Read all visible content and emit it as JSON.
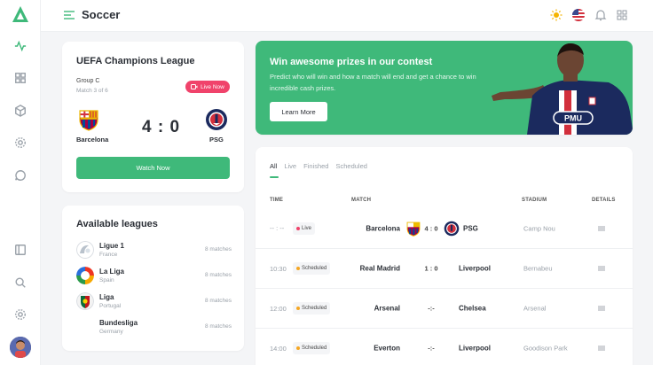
{
  "header": {
    "title": "Soccer"
  },
  "match_card": {
    "title": "UEFA Champions League",
    "group": "Group C",
    "subtitle": "Match 3 of 6",
    "live_label": "Live Now",
    "home_team": "Barcelona",
    "away_team": "PSG",
    "score": "4 : 0",
    "watch_label": "Watch Now"
  },
  "promo": {
    "title": "Win awesome prizes in our contest",
    "text": "Predict who will win and how a match will end and get a chance to win incredible cash prizes.",
    "button_label": "Learn More",
    "shirt_text": "PMU"
  },
  "leagues": {
    "title": "Available leagues",
    "items": [
      {
        "name": "Ligue 1",
        "country": "France",
        "count": "8 matches"
      },
      {
        "name": "La Liga",
        "country": "Spain",
        "count": "8 matches"
      },
      {
        "name": "Liga",
        "country": "Portugal",
        "count": "8 matches"
      },
      {
        "name": "Bundesliga",
        "country": "Germany",
        "count": "8 matches"
      }
    ]
  },
  "matches": {
    "tabs": [
      "All",
      "Live",
      "Finished",
      "Scheduled"
    ],
    "columns": {
      "time": "TIME",
      "match": "MATCH",
      "stadium": "STADIUM",
      "details": "DETAILS"
    },
    "rows": [
      {
        "time": "-- : --",
        "status": "Live",
        "home": "Barcelona",
        "score": "4 : 0",
        "away": "PSG",
        "stadium": "Camp Nou"
      },
      {
        "time": "10:30",
        "status": "Scheduled",
        "home": "Real Madrid",
        "score": "1 : 0",
        "away": "Liverpool",
        "stadium": "Bernabeu"
      },
      {
        "time": "12:00",
        "status": "Scheduled",
        "home": "Arsenal",
        "score": "-:-",
        "away": "Chelsea",
        "stadium": "Arsenal"
      },
      {
        "time": "14:00",
        "status": "Scheduled",
        "home": "Everton",
        "score": "-:-",
        "away": "Liverpool",
        "stadium": "Goodison Park"
      }
    ]
  },
  "colors": {
    "accent": "#3fb97a",
    "live": "#f0436b",
    "scheduled_dot": "#f5a623"
  },
  "icons": [
    "logo-icon",
    "activity-icon",
    "grid-icon",
    "cube-icon",
    "settings-icon",
    "chat-icon",
    "panel-icon",
    "search-icon",
    "gear-icon",
    "menu-icon",
    "sun-icon",
    "flag-us-icon",
    "bell-icon",
    "apps-icon"
  ]
}
